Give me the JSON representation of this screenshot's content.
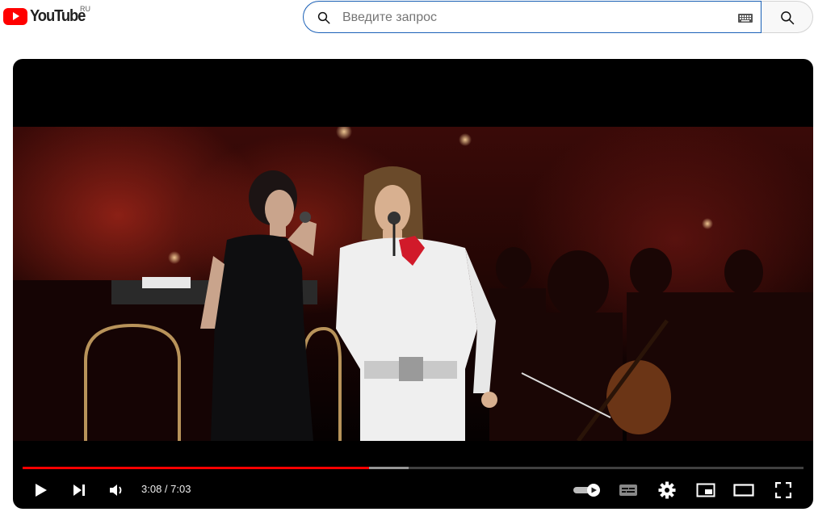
{
  "header": {
    "logo_text": "YouTube",
    "region": "RU",
    "search": {
      "placeholder": "Введите запрос",
      "value": ""
    },
    "icons": [
      "search-icon",
      "keyboard-icon",
      "search-icon"
    ]
  },
  "player": {
    "current_time": "3:08",
    "separator": " / ",
    "duration": "7:03",
    "progress": {
      "played_fraction": 0.444,
      "buffered_fraction": 0.494
    },
    "autoplay": "on",
    "colors": {
      "progress": "#ff0000",
      "brand": "#ff0000"
    },
    "controls": [
      "play-icon",
      "next-icon",
      "volume-icon",
      "autoplay-toggle",
      "subtitles-icon",
      "settings-icon",
      "miniplayer-icon",
      "theater-icon",
      "fullscreen-icon"
    ]
  }
}
